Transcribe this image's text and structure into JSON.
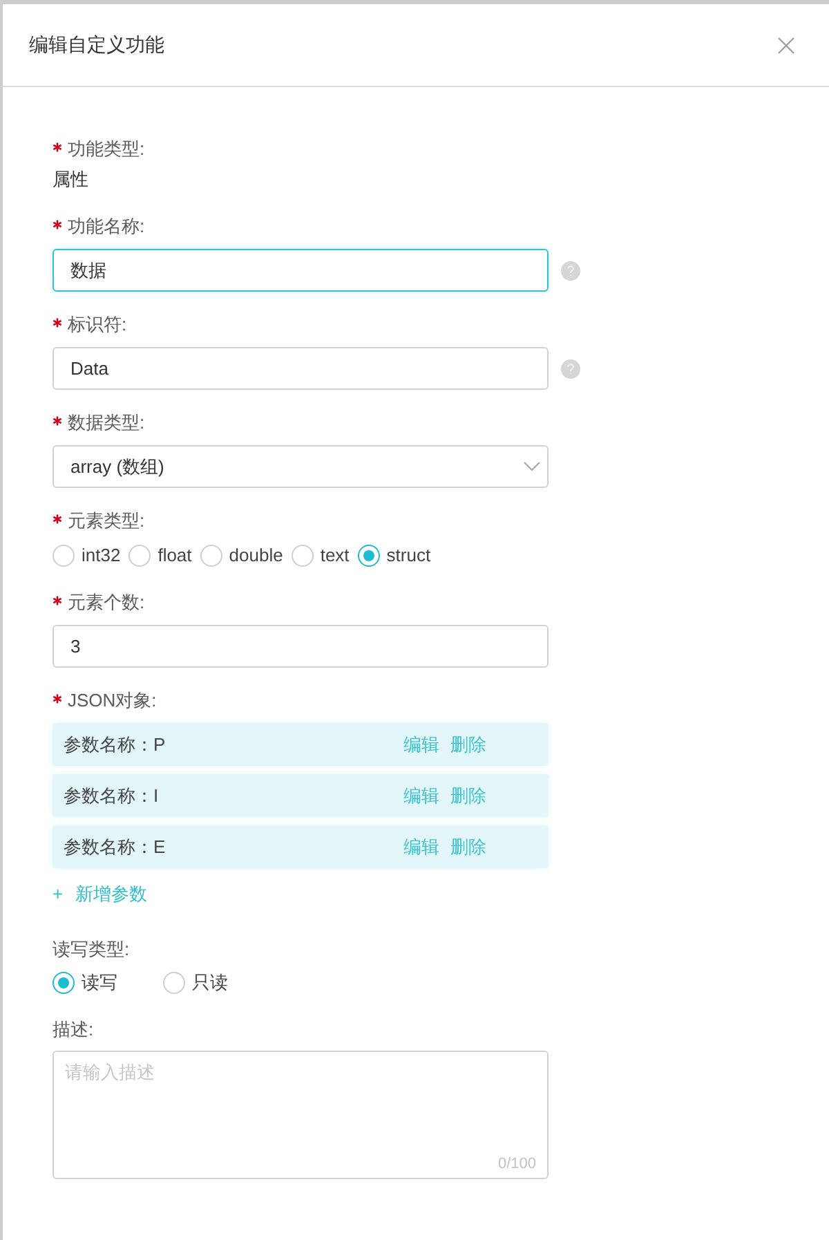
{
  "dialog": {
    "title": "编辑自定义功能"
  },
  "fields": [
    {
      "kind": "static",
      "required": true,
      "label": "功能类型:",
      "value": "属性"
    },
    {
      "kind": "input",
      "required": true,
      "label": "功能名称:",
      "value": "数据",
      "focused": true,
      "help": true
    },
    {
      "kind": "input",
      "required": true,
      "label": "标识符:",
      "value": "Data",
      "focused": false,
      "help": true
    },
    {
      "kind": "select",
      "required": true,
      "label": "数据类型:",
      "value": "array (数组)"
    },
    {
      "kind": "radio-compact",
      "required": true,
      "label": "元素类型:",
      "options": [
        {
          "label": "int32",
          "selected": false
        },
        {
          "label": "float",
          "selected": false
        },
        {
          "label": "double",
          "selected": false
        },
        {
          "label": "text",
          "selected": false
        },
        {
          "label": "struct",
          "selected": true
        }
      ]
    },
    {
      "kind": "input",
      "required": true,
      "label": "元素个数:",
      "value": "3",
      "focused": false,
      "help": false
    },
    {
      "kind": "param-list",
      "required": true,
      "label": "JSON对象:",
      "rows": [
        {
          "name": "参数名称：P",
          "edit": "编辑",
          "delete": "删除"
        },
        {
          "name": "参数名称：I",
          "edit": "编辑",
          "delete": "删除"
        },
        {
          "name": "参数名称：E",
          "edit": "编辑",
          "delete": "删除"
        }
      ],
      "add_icon": "+",
      "add_label": "新增参数"
    },
    {
      "kind": "radio-spaced",
      "required": false,
      "label": "读写类型:",
      "options": [
        {
          "label": "读写",
          "selected": true
        },
        {
          "label": "只读",
          "selected": false
        }
      ]
    },
    {
      "kind": "textarea",
      "required": false,
      "label": "描述:",
      "placeholder": "请输入描述",
      "counter": "0/100"
    }
  ]
}
